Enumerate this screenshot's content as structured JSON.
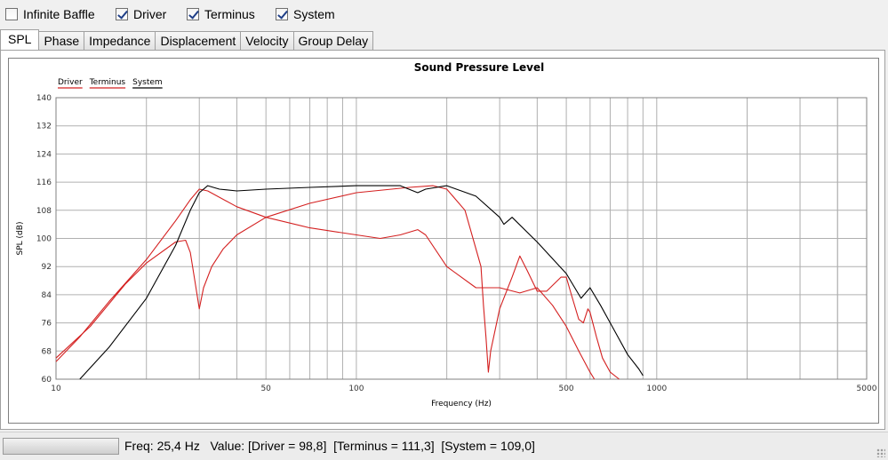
{
  "checkboxes": [
    {
      "label": "Infinite Baffle",
      "checked": false
    },
    {
      "label": "Driver",
      "checked": true
    },
    {
      "label": "Terminus",
      "checked": true
    },
    {
      "label": "System",
      "checked": true
    }
  ],
  "tabs": [
    "SPL",
    "Phase",
    "Impedance",
    "Displacement",
    "Velocity",
    "Group Delay"
  ],
  "active_tab": "SPL",
  "status": {
    "freq": "Freq: 25,4 Hz",
    "value": "Value: [Driver = 98,8]",
    "terminus": "[Terminus = 111,3]",
    "system": "[System = 109,0]"
  },
  "colors": {
    "driver": "#d42020",
    "terminus": "#d42020",
    "system": "#000000",
    "grid": "#b0b0b0"
  },
  "chart_data": {
    "type": "line",
    "title": "Sound Pressure Level",
    "xlabel": "Frequency (Hz)",
    "ylabel": "SPL (dB)",
    "xscale": "log",
    "xlim": [
      10,
      5000
    ],
    "ylim": [
      60,
      140
    ],
    "xticks": [
      10,
      50,
      100,
      500,
      1000,
      5000
    ],
    "xtick_labels": [
      "10",
      "50",
      "100",
      "500",
      "1000",
      "5000"
    ],
    "yticks": [
      60,
      68,
      76,
      84,
      92,
      100,
      108,
      116,
      124,
      132,
      140
    ],
    "ytick_labels": [
      "60",
      "68",
      "76",
      "84",
      "92",
      "100",
      "108",
      "116",
      "124",
      "132",
      "140"
    ],
    "grid": true,
    "legend": "top-left",
    "series": [
      {
        "name": "Driver",
        "color": "#d42020",
        "points": [
          [
            10,
            65
          ],
          [
            12,
            72
          ],
          [
            15,
            82
          ],
          [
            20,
            94
          ],
          [
            25,
            105
          ],
          [
            28,
            111
          ],
          [
            30,
            114
          ],
          [
            32,
            113.5
          ],
          [
            40,
            109
          ],
          [
            50,
            106
          ],
          [
            70,
            103
          ],
          [
            100,
            101
          ],
          [
            120,
            100
          ],
          [
            140,
            101
          ],
          [
            160,
            102.5
          ],
          [
            170,
            101
          ],
          [
            200,
            92
          ],
          [
            250,
            86
          ],
          [
            300,
            86
          ],
          [
            350,
            84.5
          ],
          [
            400,
            86
          ],
          [
            450,
            81
          ],
          [
            500,
            75
          ],
          [
            550,
            68
          ],
          [
            600,
            62
          ],
          [
            620,
            60
          ]
        ]
      },
      {
        "name": "Terminus",
        "color": "#d42020",
        "points": [
          [
            10,
            66
          ],
          [
            13,
            75
          ],
          [
            17,
            87
          ],
          [
            20,
            93
          ],
          [
            25,
            99
          ],
          [
            27,
            99.5
          ],
          [
            28,
            96
          ],
          [
            29,
            88
          ],
          [
            30,
            80
          ],
          [
            31,
            86
          ],
          [
            33,
            92
          ],
          [
            36,
            97
          ],
          [
            40,
            101
          ],
          [
            50,
            106
          ],
          [
            70,
            110
          ],
          [
            100,
            113
          ],
          [
            150,
            114.5
          ],
          [
            180,
            115
          ],
          [
            200,
            114
          ],
          [
            230,
            108
          ],
          [
            260,
            92
          ],
          [
            265,
            81
          ],
          [
            270,
            72
          ],
          [
            275,
            62
          ],
          [
            280,
            68
          ],
          [
            300,
            80
          ],
          [
            330,
            89
          ],
          [
            350,
            95
          ],
          [
            370,
            91
          ],
          [
            400,
            85
          ],
          [
            430,
            85
          ],
          [
            480,
            89
          ],
          [
            500,
            89
          ],
          [
            520,
            84
          ],
          [
            550,
            77
          ],
          [
            570,
            76
          ],
          [
            590,
            80
          ],
          [
            600,
            79
          ],
          [
            630,
            72
          ],
          [
            660,
            66
          ],
          [
            700,
            62
          ],
          [
            750,
            60
          ]
        ]
      },
      {
        "name": "System",
        "color": "#000000",
        "points": [
          [
            12,
            60
          ],
          [
            15,
            69
          ],
          [
            20,
            83
          ],
          [
            25,
            98
          ],
          [
            28,
            108
          ],
          [
            30,
            113
          ],
          [
            32,
            115
          ],
          [
            35,
            114
          ],
          [
            40,
            113.5
          ],
          [
            50,
            114
          ],
          [
            70,
            114.5
          ],
          [
            100,
            115
          ],
          [
            140,
            115
          ],
          [
            160,
            113
          ],
          [
            170,
            114
          ],
          [
            200,
            115
          ],
          [
            250,
            112
          ],
          [
            300,
            106
          ],
          [
            310,
            104
          ],
          [
            330,
            106
          ],
          [
            400,
            99
          ],
          [
            500,
            90
          ],
          [
            560,
            83
          ],
          [
            600,
            86
          ],
          [
            650,
            81
          ],
          [
            700,
            76
          ],
          [
            800,
            67
          ],
          [
            870,
            63
          ],
          [
            900,
            61
          ]
        ]
      }
    ]
  }
}
